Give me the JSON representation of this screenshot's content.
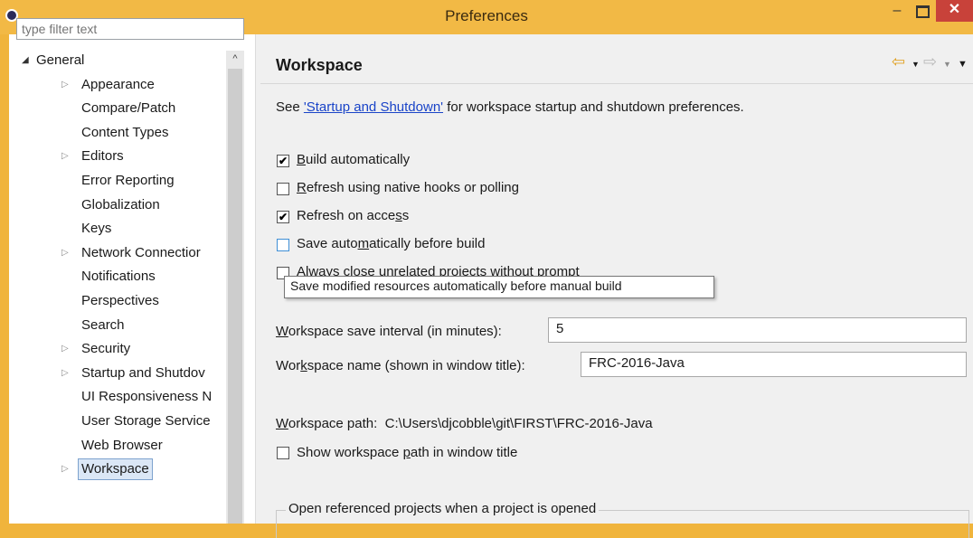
{
  "window": {
    "title": "Preferences",
    "minimize": "–",
    "close": "✕"
  },
  "filter": {
    "placeholder": "type filter text"
  },
  "tree": {
    "items": [
      {
        "label": "General",
        "expand": "◢"
      },
      {
        "label": "Appearance",
        "expand": "▷"
      },
      {
        "label": "Compare/Patch"
      },
      {
        "label": "Content Types"
      },
      {
        "label": "Editors",
        "expand": "▷"
      },
      {
        "label": "Error Reporting"
      },
      {
        "label": "Globalization"
      },
      {
        "label": "Keys"
      },
      {
        "label": "Network Connectior",
        "expand": "▷"
      },
      {
        "label": "Notifications"
      },
      {
        "label": "Perspectives"
      },
      {
        "label": "Search"
      },
      {
        "label": "Security",
        "expand": "▷"
      },
      {
        "label": "Startup and Shutdov",
        "expand": "▷"
      },
      {
        "label": "UI Responsiveness N"
      },
      {
        "label": "User Storage Service"
      },
      {
        "label": "Web Browser"
      },
      {
        "label": "Workspace",
        "expand": "▷",
        "selected": true
      }
    ]
  },
  "page": {
    "title": "Workspace",
    "nav": {
      "back": "⇦",
      "forward": "⇨",
      "menu": "▼"
    },
    "intro": {
      "prefix": "See ",
      "link": "'Startup and Shutdown'",
      "suffix": " for workspace startup and shutdown preferences."
    },
    "options": [
      {
        "label_a": "",
        "mnemonic": "B",
        "label_b": "uild automatically",
        "checked": true
      },
      {
        "label_a": "",
        "mnemonic": "R",
        "label_b": "efresh using native hooks or polling",
        "checked": false
      },
      {
        "label_a": "Refresh on acce",
        "mnemonic": "s",
        "label_b": "s",
        "checked": true
      },
      {
        "label_a": "Save auto",
        "mnemonic": "m",
        "label_b": "atically before build",
        "checked": false
      },
      {
        "label_a": "Always close unrelated projects without prompt",
        "mnemonic": "",
        "label_b": "",
        "checked": false
      }
    ],
    "tooltip": "Save modified resources automatically before manual build",
    "save_interval": {
      "label_a": "",
      "mnemonic": "W",
      "label_b": "orkspace save interval (in minutes):",
      "value": "5"
    },
    "workspace_name": {
      "label_a": "Wor",
      "mnemonic": "k",
      "label_b": "space name (shown in window title):",
      "value": "FRC-2016-Java"
    },
    "workspace_path": {
      "label_a": "",
      "mnemonic": "W",
      "label_b": "orkspace path:",
      "value": "C:\\Users\\djcobble\\git\\FIRST\\FRC-2016-Java"
    },
    "show_path": {
      "label_a": "Show workspace ",
      "mnemonic": "p",
      "label_b": "ath in window title",
      "checked": false
    },
    "group_title": "Open referenced projects when a project is opened"
  }
}
